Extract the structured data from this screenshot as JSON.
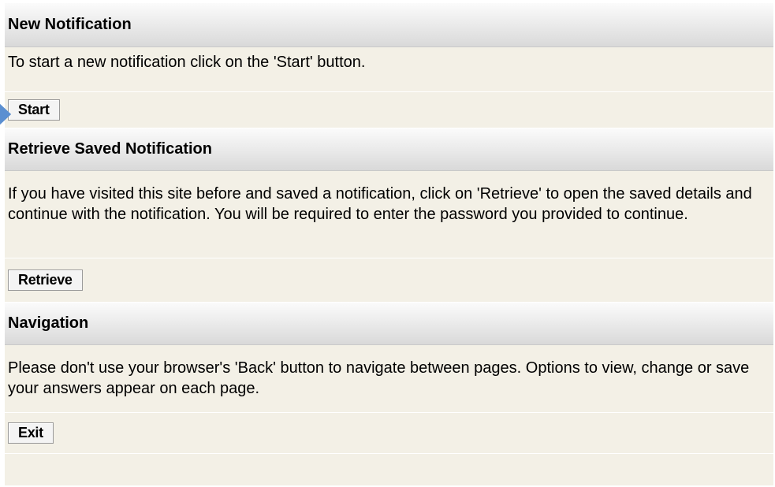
{
  "sections": [
    {
      "header": "New Notification",
      "text": "To start a new notification click on the 'Start' button.",
      "button_label": "Start"
    },
    {
      "header": "Retrieve Saved Notification",
      "text": "If you have visited this site before and saved a notification, click on 'Retrieve' to open the saved details and continue with the notification. You will be required to enter the password you provided to continue.",
      "button_label": "Retrieve"
    },
    {
      "header": "Navigation",
      "text": "Please don't use your browser's 'Back' button to navigate between pages. Options to view, change or save your answers appear on each page.",
      "button_label": "Exit"
    }
  ],
  "colors": {
    "panel_background": "#f3f0e6",
    "pointer_arrow": "#5b8fd1"
  },
  "icons": {
    "pointer": "arrow-right-icon"
  }
}
